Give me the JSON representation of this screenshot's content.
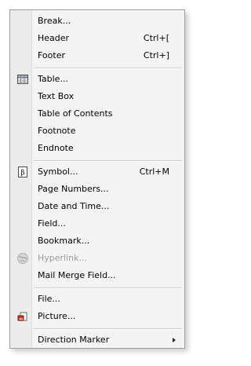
{
  "menu": {
    "items": [
      {
        "label": "Break...",
        "shortcut": ""
      },
      {
        "label": "Header",
        "shortcut": "Ctrl+["
      },
      {
        "label": "Footer",
        "shortcut": "Ctrl+]"
      },
      {
        "label": "Table...",
        "shortcut": "",
        "icon": "table-icon"
      },
      {
        "label": "Text Box",
        "shortcut": ""
      },
      {
        "label": "Table of Contents",
        "shortcut": ""
      },
      {
        "label": "Footnote",
        "shortcut": ""
      },
      {
        "label": "Endnote",
        "shortcut": ""
      },
      {
        "label": "Symbol...",
        "shortcut": "Ctrl+M",
        "icon": "symbol-icon"
      },
      {
        "label": "Page Numbers...",
        "shortcut": ""
      },
      {
        "label": "Date and Time...",
        "shortcut": ""
      },
      {
        "label": "Field...",
        "shortcut": ""
      },
      {
        "label": "Bookmark...",
        "shortcut": ""
      },
      {
        "label": "Hyperlink...",
        "shortcut": "",
        "icon": "hyperlink-icon",
        "disabled": true
      },
      {
        "label": "Mail Merge Field...",
        "shortcut": ""
      },
      {
        "label": "File...",
        "shortcut": ""
      },
      {
        "label": "Picture...",
        "shortcut": "",
        "icon": "picture-icon"
      },
      {
        "label": "Direction Marker",
        "shortcut": "",
        "submenu": true
      }
    ]
  }
}
